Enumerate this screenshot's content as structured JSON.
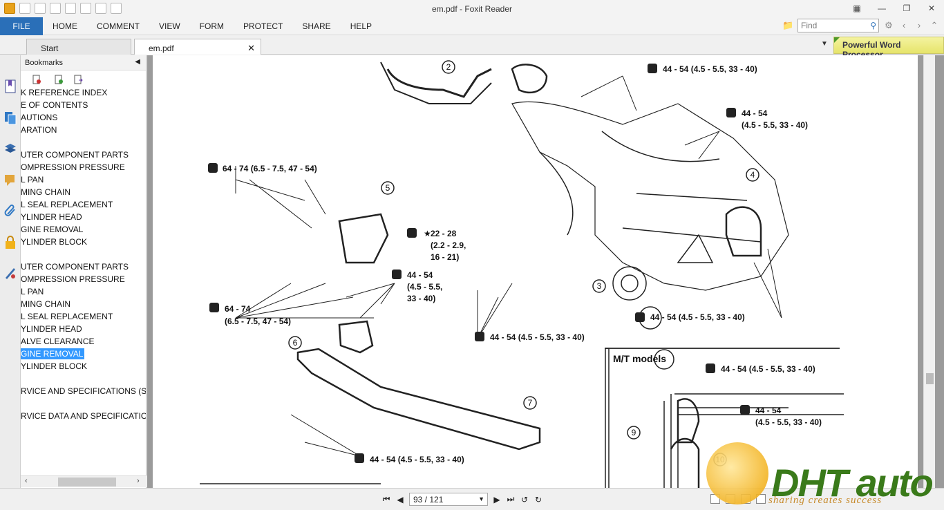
{
  "window": {
    "title": "em.pdf - Foxit Reader"
  },
  "menu": [
    "FILE",
    "HOME",
    "COMMENT",
    "VIEW",
    "FORM",
    "PROTECT",
    "SHARE",
    "HELP"
  ],
  "search": {
    "placeholder": "Find"
  },
  "tabs": [
    {
      "label": "Start"
    },
    {
      "label": "em.pdf"
    }
  ],
  "promo": {
    "label": "Powerful Word Processor"
  },
  "bookmarks": {
    "title": "Bookmarks",
    "items": [
      "K REFERENCE INDEX",
      "E OF CONTENTS",
      "AUTIONS",
      "ARATION",
      "",
      "UTER COMPONENT PARTS",
      "OMPRESSION PRESSURE",
      "L PAN",
      "MING CHAIN",
      "L SEAL REPLACEMENT",
      "YLINDER HEAD",
      "GINE REMOVAL",
      "YLINDER BLOCK",
      "",
      "UTER COMPONENT PARTS",
      "OMPRESSION PRESSURE",
      "L PAN",
      "MING CHAIN",
      "L SEAL REPLACEMENT",
      "YLINDER HEAD",
      "ALVE CLEARANCE",
      "GINE REMOVAL",
      "YLINDER BLOCK",
      "",
      "RVICE AND SPECIFICATIONS (SI",
      "",
      "RVICE DATA AND SPECIFICATIO"
    ],
    "selected_index": 21
  },
  "diagram": {
    "labels": {
      "t1": "44 - 54 (4.5 - 5.5, 33 - 40)",
      "t2a": "44 - 54",
      "t2b": "(4.5 - 5.5, 33 - 40)",
      "t3": "64 - 74 (6.5 - 7.5, 47 - 54)",
      "t4a": "22 - 28",
      "t4b": "(2.2 - 2.9,",
      "t4c": "16 - 21)",
      "t5a": "44 - 54",
      "t5b": "(4.5 - 5.5,",
      "t5c": "33 - 40)",
      "t6a": "64 - 74",
      "t6b": "(6.5 - 7.5, 47 - 54)",
      "t7": "44 - 54 (4.5 - 5.5, 33 - 40)",
      "t8": "44 - 54 (4.5 - 5.5, 33 - 40)",
      "t9": "44 - 54 (4.5 - 5.5, 33 - 40)",
      "mt_title": "M/T models",
      "t10": "44 - 54 (4.5 - 5.5, 33 - 40)",
      "t11a": "44 - 54",
      "t11b": "(4.5 - 5.5, 33 - 40)"
    },
    "callouts": [
      "2",
      "4",
      "5",
      "3",
      "6",
      "7",
      "9",
      "10"
    ]
  },
  "status": {
    "page": "93 / 121"
  },
  "watermark": {
    "brand": "DHT auto",
    "tagline": "sharing creates success"
  }
}
